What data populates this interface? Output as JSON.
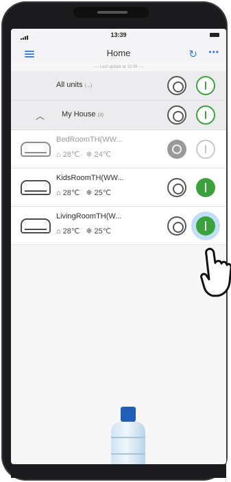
{
  "status_bar": {
    "time": "13:39"
  },
  "nav": {
    "title": "Home"
  },
  "last_update": "---- Last update at 13:39 ----",
  "groups": [
    {
      "label": "All units",
      "count": "(...)"
    },
    {
      "label": "My House",
      "count": "(3)"
    }
  ],
  "units": [
    {
      "name": "BedRoomTH(WW...",
      "indoor_temp": "28℃",
      "set_temp": "24℃",
      "state": "offline"
    },
    {
      "name": "KidsRoomTH(WW...",
      "indoor_temp": "28℃",
      "set_temp": "25℃",
      "state": "on"
    },
    {
      "name": "LivingRoomTH(W...",
      "indoor_temp": "28℃",
      "set_temp": "25℃",
      "state": "on"
    }
  ],
  "icons": {
    "menu": "menu-icon",
    "refresh": "refresh-icon",
    "more": "more-icon",
    "chevron": "chevron-up-icon",
    "house_temp": "house-temperature-icon",
    "mode": "snowflake-icon",
    "power_off": "power-off-icon",
    "power_on": "power-on-icon"
  },
  "colors": {
    "accent": "#2f79d6",
    "on_green": "#3aa23a",
    "off_grey": "#9a9a9a"
  }
}
